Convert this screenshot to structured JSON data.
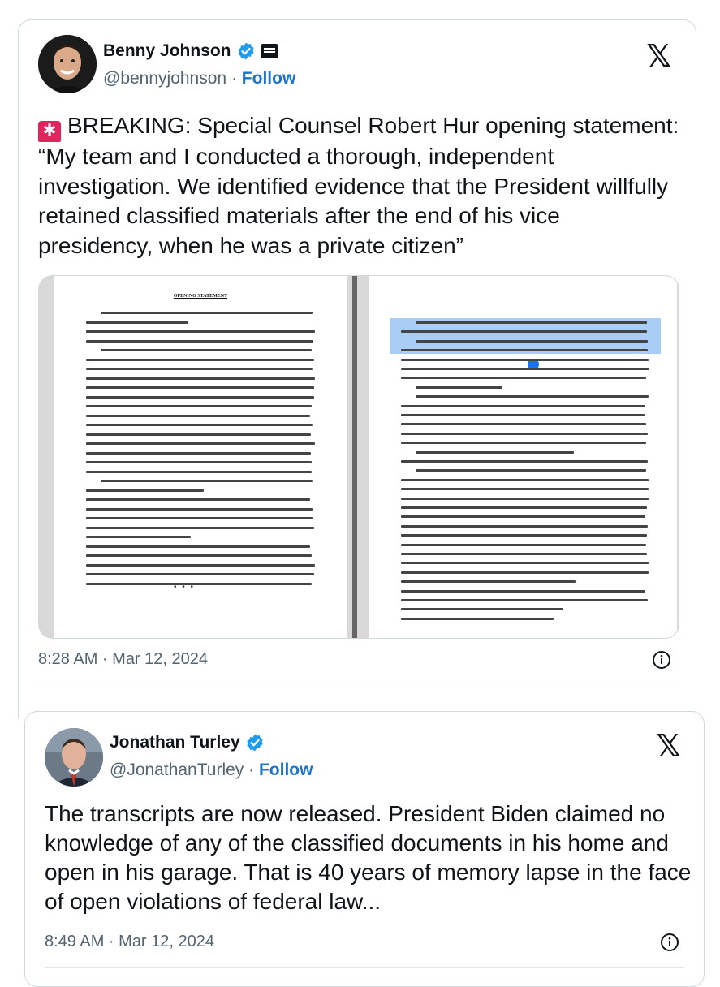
{
  "tweets": [
    {
      "author": {
        "name": "Benny Johnson",
        "handle": "@bennyjohnson",
        "separator": "·",
        "follow_label": "Follow"
      },
      "text": "BREAKING: Special Counsel Robert Hur opening statement: “My team and I conducted a thorough, independent investigation. We identified evidence that the President willfully retained classified materials after the end of his vice presidency, when he was a private citizen”",
      "media": {
        "left_page_title": "OPENING STATEMENT"
      },
      "timestamp": "8:28 AM · Mar 12, 2024"
    },
    {
      "author": {
        "name": "Jonathan Turley",
        "handle": "@JonathanTurley",
        "separator": "·",
        "follow_label": "Follow"
      },
      "text": "The transcripts are now released. President Biden claimed no knowledge of any of the classified documents in his home and open in his garage. That is 40 years of memory lapse in the face of open violations of federal law...",
      "timestamp": "8:49 AM · Mar 12, 2024"
    }
  ],
  "icons": {
    "verified": "verified-badge-icon",
    "affiliation": "news-affiliation-icon",
    "platform": "x-logo-icon",
    "alarm": "rotating-light-icon",
    "info": "info-icon"
  },
  "colors": {
    "verified": "#1d9bf0",
    "follow": "#1d73c9",
    "muted": "#536471",
    "highlight": "#a9cdf5"
  }
}
